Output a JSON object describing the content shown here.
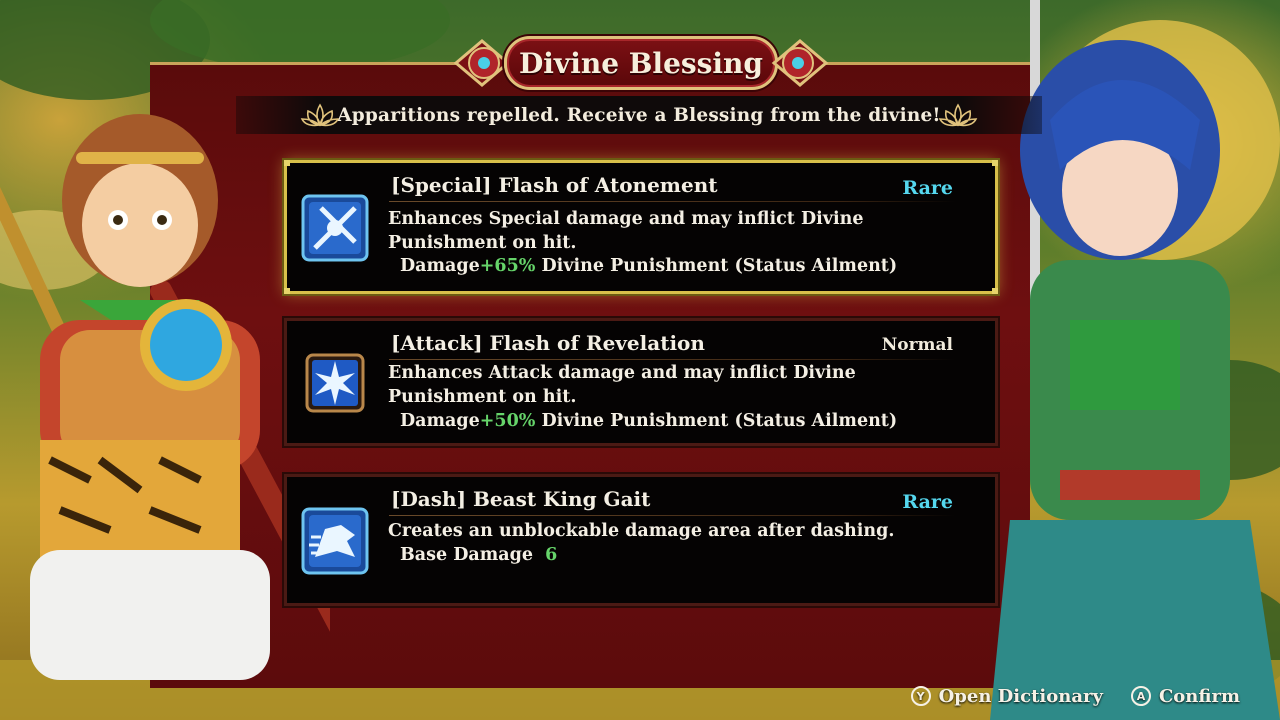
{
  "header": {
    "title": "Divine Blessing",
    "subtitle": "Apparitions repelled. Receive a Blessing from the divine!"
  },
  "cards": [
    {
      "name": "[Special] Flash of Atonement",
      "rarity": "Rare",
      "description": "Enhances Special damage and may inflict Divine Punishment on hit.",
      "stat_label": "Damage",
      "stat_value": "+65%",
      "stat_suffix": " Divine Punishment (Status Ailment)",
      "icon": "special-sword-icon",
      "selected": true
    },
    {
      "name": "[Attack] Flash of Revelation",
      "rarity": "Normal",
      "description": "Enhances Attack damage and may inflict Divine Punishment on hit.",
      "stat_label": "Damage",
      "stat_value": "+50%",
      "stat_suffix": " Divine Punishment (Status Ailment)",
      "icon": "attack-burst-icon",
      "selected": false
    },
    {
      "name": "[Dash] Beast King Gait",
      "rarity": "Rare",
      "description": "Creates an unblockable damage area after dashing.",
      "stat_label": "Base Damage",
      "stat_value": "6",
      "stat_suffix": "",
      "icon": "dash-beast-icon",
      "selected": false
    }
  ],
  "footer": {
    "dictionary_button_glyph": "Y",
    "dictionary_label": "Open Dictionary",
    "confirm_button_glyph": "A",
    "confirm_label": "Confirm"
  },
  "colors": {
    "panel": "#6e0f10",
    "gold": "#e0c27c",
    "rare": "#55d7ee",
    "bonus_green": "#66d46a",
    "selected_border": "#d8c04a"
  }
}
